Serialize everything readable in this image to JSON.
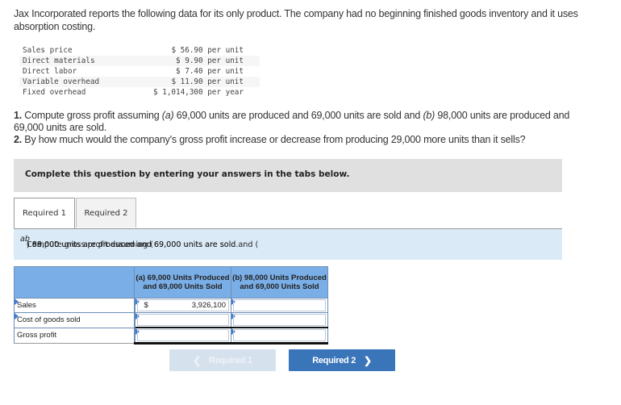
{
  "intro": "Jax Incorporated reports the following data for its only product. The company had no beginning finished goods inventory and it uses absorption costing.",
  "cost_data": [
    {
      "label": "Sales price",
      "value": "$ 56.90 per unit"
    },
    {
      "label": "Direct materials",
      "value": "$ 9.90 per unit"
    },
    {
      "label": "Direct labor",
      "value": "$ 7.40 per unit"
    },
    {
      "label": "Variable overhead",
      "value": "$ 11.90 per unit"
    },
    {
      "label": "Fixed overhead",
      "value": "$ 1,014,300 per year"
    }
  ],
  "questions": {
    "q1_num": "1.",
    "q1_a": " Compute gross profit assuming ",
    "q1_a_letter": "(a)",
    "q1_b": " 69,000 units are produced and 69,000 units are sold and ",
    "q1_b_letter": "(b)",
    "q1_c": " 98,000 units are produced and 69,000 units are sold.",
    "q2_num": "2.",
    "q2_text": " By how much would the company's gross profit increase or decrease from producing 29,000 more units than it sells?"
  },
  "instruction": "Complete this question by entering your answers in the tabs below.",
  "tabs": [
    {
      "label": "Required 1",
      "active": true
    },
    {
      "label": "Required 2",
      "active": false
    }
  ],
  "prompt": {
    "a": "Compute gross profit assuming (",
    "a_letter": "a",
    "b": ") 69,000 units are produced and 69,000 units are sold and (",
    "b_letter": "b",
    "c": ") 98,000 units are produced and 69,000 units are sold."
  },
  "answer_table": {
    "headers": [
      "",
      "(a) 69,000 Units Produced and 69,000 Units Sold",
      "(b) 98,000 Units Produced and 69,000 Units Sold"
    ],
    "rows": [
      {
        "label": "Sales",
        "a_currency": "$",
        "a_value": "3,926,100",
        "b_value": ""
      },
      {
        "label": "Cost of goods sold",
        "a_currency": "",
        "a_value": "",
        "b_value": ""
      },
      {
        "label": "Gross profit",
        "a_currency": "",
        "a_value": "",
        "b_value": ""
      }
    ]
  },
  "nav": {
    "prev_label": "Required 1",
    "next_label": "Required 2",
    "prev_icon": "chevron-left-icon",
    "next_icon": "chevron-right-icon"
  }
}
